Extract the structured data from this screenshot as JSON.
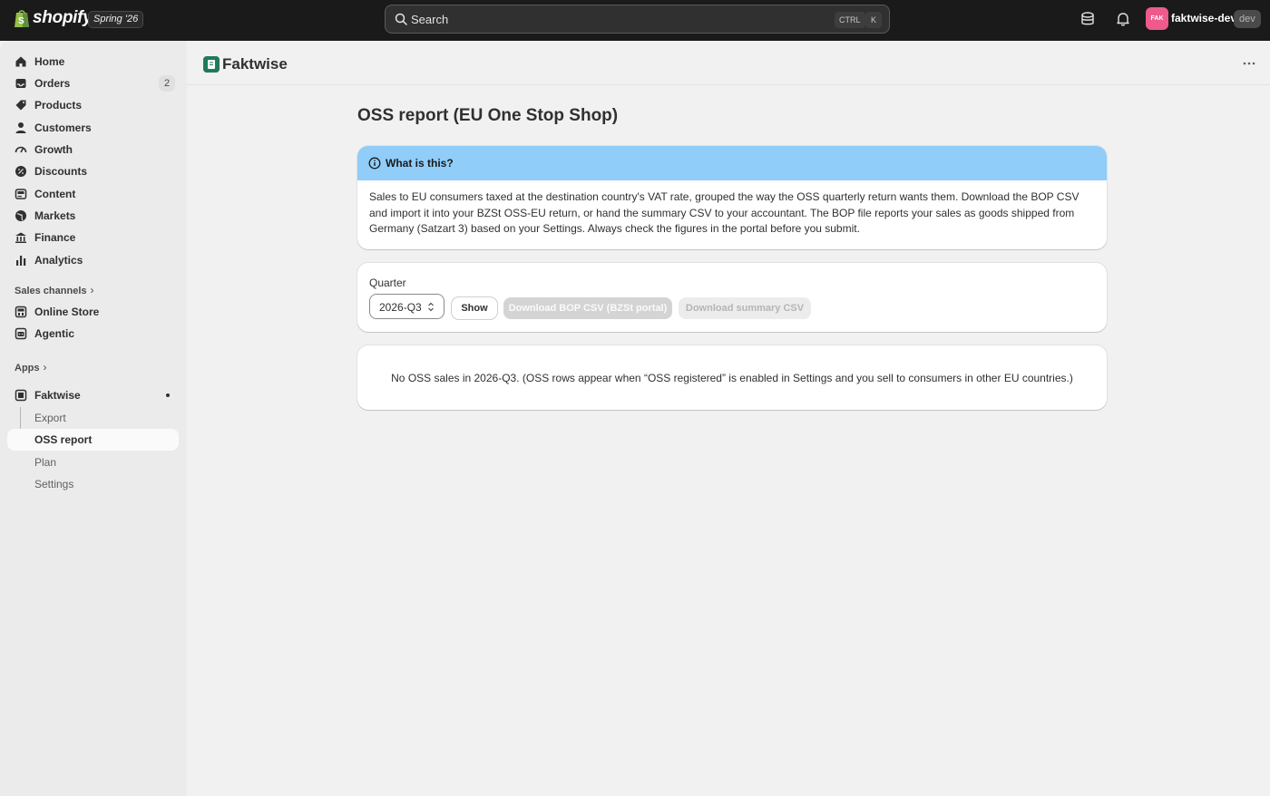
{
  "topbar": {
    "brand": "shopify",
    "edition_badge": "Spring '26",
    "search_placeholder": "Search",
    "shortcut_ctrl": "CTRL",
    "shortcut_key": "K",
    "avatar_initials": "FAK",
    "store_name": "faktwise-dev",
    "env_badge": "dev",
    "icons": [
      "shopify-bag-icon",
      "search-icon",
      "database-icon",
      "bell-icon"
    ]
  },
  "sidebar": {
    "items": [
      {
        "label": "Home",
        "icon": "home-icon"
      },
      {
        "label": "Orders",
        "icon": "inbox-icon",
        "count": "2"
      },
      {
        "label": "Products",
        "icon": "tag-icon"
      },
      {
        "label": "Customers",
        "icon": "person-icon"
      },
      {
        "label": "Growth",
        "icon": "gauge-icon"
      },
      {
        "label": "Discounts",
        "icon": "discount-icon"
      },
      {
        "label": "Content",
        "icon": "content-icon"
      },
      {
        "label": "Markets",
        "icon": "globe-icon"
      },
      {
        "label": "Finance",
        "icon": "bank-icon"
      },
      {
        "label": "Analytics",
        "icon": "bar-chart-icon"
      }
    ],
    "sales_channels_label": "Sales channels",
    "channels": [
      {
        "label": "Online Store",
        "icon": "store-icon"
      },
      {
        "label": "Agentic",
        "icon": "robot-icon"
      }
    ],
    "apps_label": "Apps",
    "app": {
      "label": "Faktwise",
      "subitems": [
        "Export",
        "OSS report",
        "Plan",
        "Settings"
      ],
      "active_subitem": "OSS report"
    }
  },
  "header": {
    "app_title": "Faktwise"
  },
  "main": {
    "page_title": "OSS report (EU One Stop Shop)",
    "info_banner": {
      "title": "What is this?",
      "body": "Sales to EU consumers taxed at the destination country's VAT rate, grouped the way the OSS quarterly return wants them. Download the BOP CSV and import it into your BZSt OSS-EU return, or hand the summary CSV to your accountant. The BOP file reports your sales as goods shipped from Germany (Satzart 3) based on your Settings. Always check the figures in the portal before you submit."
    },
    "quarter_form": {
      "label": "Quarter",
      "selected_value": "2026-Q3",
      "show_button": "Show",
      "download_bop_button": "Download BOP CSV (BZSt portal)",
      "download_summary_button": "Download summary CSV"
    },
    "empty_state": "No OSS sales in 2026-Q3. (OSS rows appear when “OSS registered” is enabled in Settings and you sell to consumers in other EU countries.)"
  },
  "colors": {
    "topbar_bg": "#1a1a1a",
    "banner_bg": "#90cdf8",
    "avatar_bg": "#ef5a8c",
    "app_logo": "#1f7a5c"
  }
}
